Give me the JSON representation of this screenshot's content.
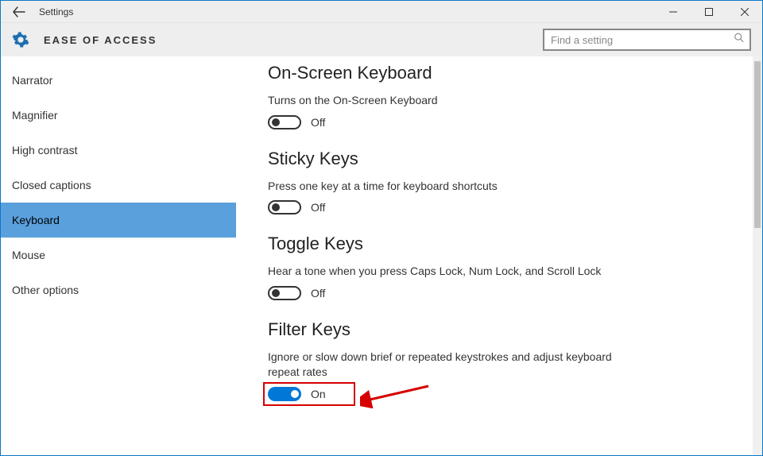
{
  "window": {
    "title": "Settings"
  },
  "header": {
    "title": "EASE OF ACCESS"
  },
  "search": {
    "placeholder": "Find a setting"
  },
  "sidebar": {
    "items": [
      {
        "label": "Narrator"
      },
      {
        "label": "Magnifier"
      },
      {
        "label": "High contrast"
      },
      {
        "label": "Closed captions"
      },
      {
        "label": "Keyboard"
      },
      {
        "label": "Mouse"
      },
      {
        "label": "Other options"
      }
    ],
    "selected_index": 4
  },
  "sections": {
    "osk": {
      "title": "On-Screen Keyboard",
      "desc": "Turns on the On-Screen Keyboard",
      "state_label": "Off",
      "on": false
    },
    "sticky": {
      "title": "Sticky Keys",
      "desc": "Press one key at a time for keyboard shortcuts",
      "state_label": "Off",
      "on": false
    },
    "toggle": {
      "title": "Toggle Keys",
      "desc": "Hear a tone when you press Caps Lock, Num Lock, and Scroll Lock",
      "state_label": "Off",
      "on": false
    },
    "filter": {
      "title": "Filter Keys",
      "desc": "Ignore or slow down brief or repeated keystrokes and adjust keyboard repeat rates",
      "state_label": "On",
      "on": true
    }
  },
  "annotation": {
    "type": "highlight-arrow",
    "target": "filter-keys-toggle"
  }
}
